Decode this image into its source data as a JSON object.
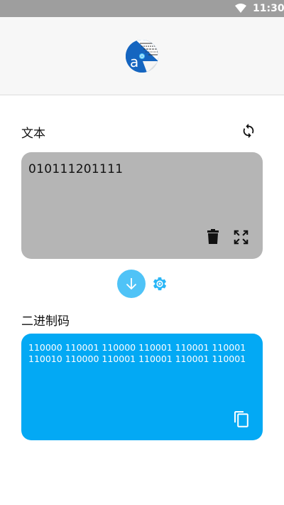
{
  "status_bar": {
    "time": "11:30",
    "icons": [
      "wifi-icon"
    ]
  },
  "header": {
    "logo_letter": "a",
    "logo_icon": "app-logo-icon"
  },
  "text_section": {
    "title": "文本",
    "refresh_icon": "refresh-icon",
    "input_value": "010111201111",
    "delete_icon": "trash-icon",
    "expand_icon": "fullscreen-icon"
  },
  "controls": {
    "convert_icon": "arrow-down-icon",
    "settings_icon": "gear-icon"
  },
  "binary_section": {
    "title": "二进制码",
    "output_value": "110000 110001 110000 110001 110001 110001 110010 110000 110001 110001 110001 110001",
    "copy_icon": "copy-icon"
  },
  "colors": {
    "status_bar": "#9e9e9e",
    "text_card": "#b5b5b5",
    "binary_card": "#03a9f4",
    "convert_button": "#4fc3f7",
    "settings_icon": "#29b6f6"
  }
}
